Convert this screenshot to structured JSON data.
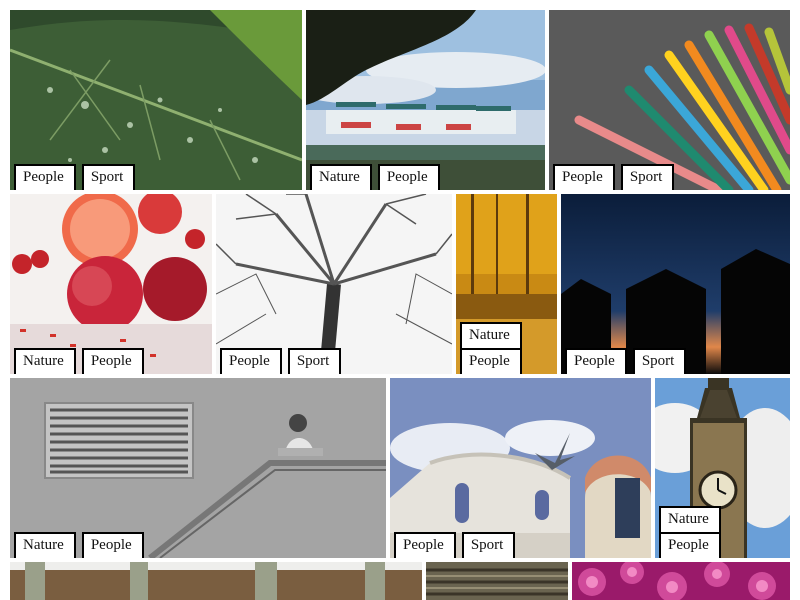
{
  "tiles": [
    {
      "name": "leaf-droplets",
      "tags": [
        "People",
        "Sport"
      ]
    },
    {
      "name": "lake-boats",
      "tags": [
        "Nature",
        "People"
      ]
    },
    {
      "name": "colored-pencils",
      "tags": [
        "People",
        "Sport"
      ]
    },
    {
      "name": "fruit-still-life",
      "tags": [
        "Nature",
        "People"
      ]
    },
    {
      "name": "bare-tree",
      "tags": [
        "People",
        "Sport"
      ]
    },
    {
      "name": "autumn-forest",
      "tags": [
        "Nature",
        "People"
      ]
    },
    {
      "name": "night-sheds",
      "tags": [
        "People",
        "Sport"
      ]
    },
    {
      "name": "concrete-woman",
      "tags": [
        "Nature",
        "People"
      ]
    },
    {
      "name": "pigeon-rooftop",
      "tags": [
        "People",
        "Sport"
      ]
    },
    {
      "name": "big-ben",
      "tags": [
        "Nature",
        "People"
      ]
    },
    {
      "name": "building-facade",
      "tags": []
    },
    {
      "name": "wooden-ceiling",
      "tags": []
    },
    {
      "name": "pink-flower",
      "tags": []
    }
  ]
}
